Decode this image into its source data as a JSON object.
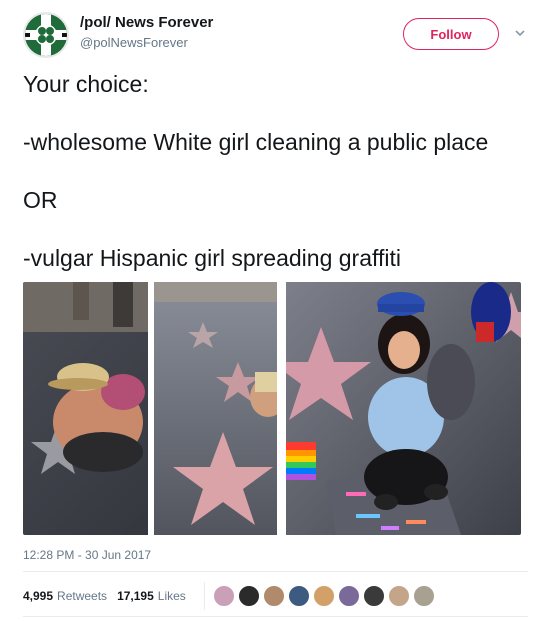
{
  "header": {
    "display_name": "/pol/ News Forever",
    "handle": "@polNewsForever",
    "follow_label": "Follow"
  },
  "tweet": {
    "lines": [
      "Your choice:",
      "-wholesome White girl cleaning a public place",
      "OR",
      "-vulgar Hispanic girl spreading graffiti"
    ],
    "timestamp": "12:28 PM - 30 Jun 2017"
  },
  "stats": {
    "retweets_count": "4,995",
    "retweets_label": "Retweets",
    "likes_count": "17,195",
    "likes_label": "Likes"
  },
  "icons": {
    "caret": "chevron-down-icon",
    "avatar": "clover-emblem"
  },
  "colors": {
    "follow_accent": "#e0245e",
    "secondary_text": "#657786",
    "divider": "#e6ecf0"
  },
  "liker_colors": [
    "#c9a0b8",
    "#2b2b2b",
    "#b08a6a",
    "#3d5a80",
    "#d4a06a",
    "#7a6a9a",
    "#3a3a3a",
    "#c4a58a",
    "#a8a090"
  ]
}
